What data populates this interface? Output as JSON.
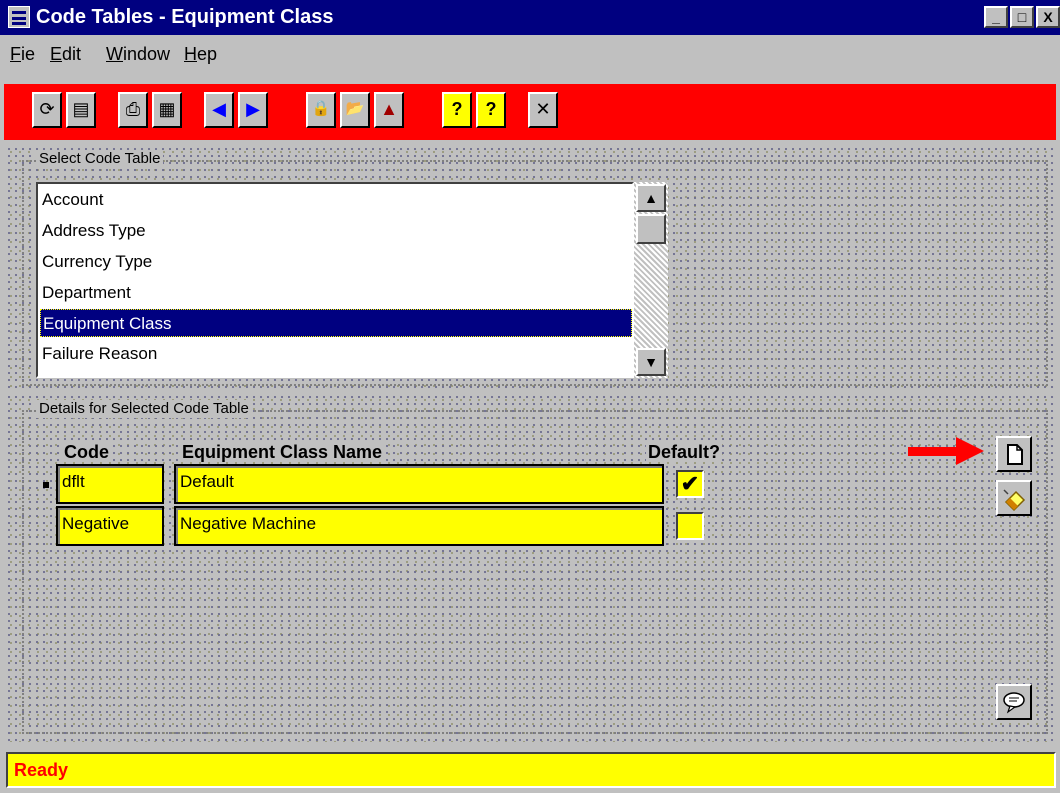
{
  "window": {
    "title": "Code Tables - Equipment Class",
    "controls": {
      "minimize": "_",
      "maximize": "□",
      "close": "X"
    }
  },
  "menu": {
    "items": [
      {
        "label": "Fie"
      },
      {
        "label": "Edit"
      },
      {
        "label": "Window"
      },
      {
        "label": "Hep"
      }
    ]
  },
  "toolbar": {
    "buttons": [
      {
        "icon": "refresh-icon",
        "glyph": "⟳"
      },
      {
        "icon": "save-icon",
        "glyph": "▤"
      },
      {
        "icon": "print-icon",
        "glyph": "⎙"
      },
      {
        "icon": "print-preview-icon",
        "glyph": "▦"
      },
      {
        "icon": "previous-icon",
        "glyph": "◀"
      },
      {
        "icon": "next-icon",
        "glyph": "▶"
      },
      {
        "icon": "lock-icon",
        "glyph": "🔒"
      },
      {
        "icon": "open-folder-icon",
        "glyph": "📂"
      },
      {
        "icon": "chart-icon",
        "glyph": "▲"
      },
      {
        "icon": "help-icon",
        "glyph": "?"
      },
      {
        "icon": "context-help-icon",
        "glyph": "?"
      },
      {
        "icon": "close-icon",
        "glyph": "✕"
      }
    ],
    "color": "#ff0000"
  },
  "select_group": {
    "label": "Select Code Table",
    "items": [
      {
        "label": "Account"
      },
      {
        "label": "Address Type"
      },
      {
        "label": "Currency Type"
      },
      {
        "label": "Department"
      },
      {
        "label": "Equipment Class"
      },
      {
        "label": "Failure Reason"
      }
    ],
    "selected": "Equipment Class",
    "scroll_up": "▲",
    "scroll_down": "▼"
  },
  "details_group": {
    "label": "Details for Selected Code Table",
    "columns": {
      "code": "Code",
      "name": "Equipment Class Name",
      "default": "Default?"
    },
    "rows": [
      {
        "code": "dflt",
        "name": "Default",
        "default": true,
        "default_mark": "✔"
      },
      {
        "code": "Negative",
        "name": "Negative Machine",
        "default": false,
        "default_mark": ""
      }
    ],
    "arrow_color": "#ff0000"
  },
  "status": {
    "text": "Ready",
    "text_color": "#ff0000",
    "bg_color": "#ffff00"
  }
}
